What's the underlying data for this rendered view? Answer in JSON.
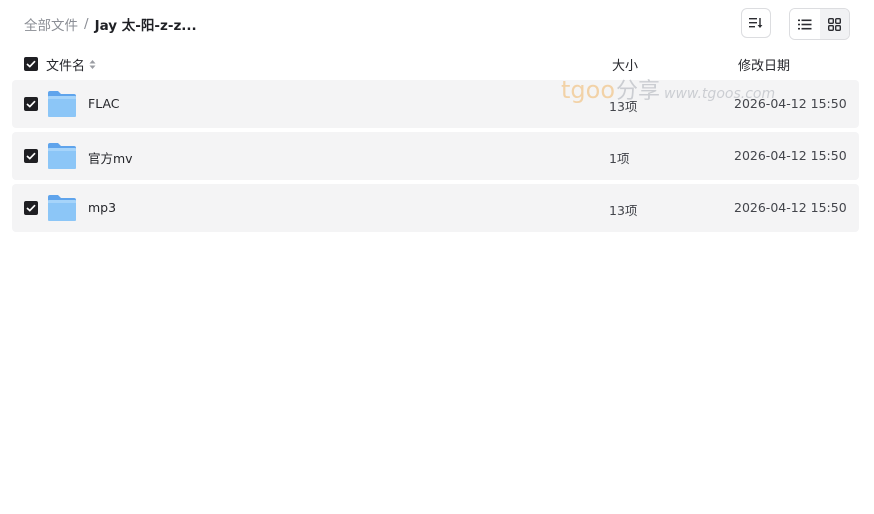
{
  "breadcrumb": {
    "root": "全部文件",
    "separator": "/",
    "current": "Jay 太-阳-z-z..."
  },
  "toolbar": {
    "sort_icon": "sort-lines-icon",
    "list_view_icon": "list-view-icon",
    "grid_view_icon": "grid-view-icon",
    "active_view": "list"
  },
  "columns": {
    "name": "文件名",
    "size": "大小",
    "date": "修改日期"
  },
  "select_all_checked": true,
  "files": [
    {
      "name": "FLAC",
      "size": "13项",
      "date": "2026-04-12 15:50",
      "checked": true,
      "icon": "folder-icon"
    },
    {
      "name": "官方mv",
      "size": "1项",
      "date": "2026-04-12 15:50",
      "checked": true,
      "icon": "folder-icon"
    },
    {
      "name": "mp3",
      "size": "13项",
      "date": "2026-04-12 15:50",
      "checked": true,
      "icon": "folder-icon"
    }
  ],
  "watermark": {
    "brand": "tgoo",
    "cn": "分享",
    "url": "www.tgoos.com"
  },
  "colors": {
    "row_bg": "#f4f4f5",
    "checkbox": "#1f1f23",
    "folder": "#79b8f3",
    "watermark_brand": "#f0a94a"
  }
}
